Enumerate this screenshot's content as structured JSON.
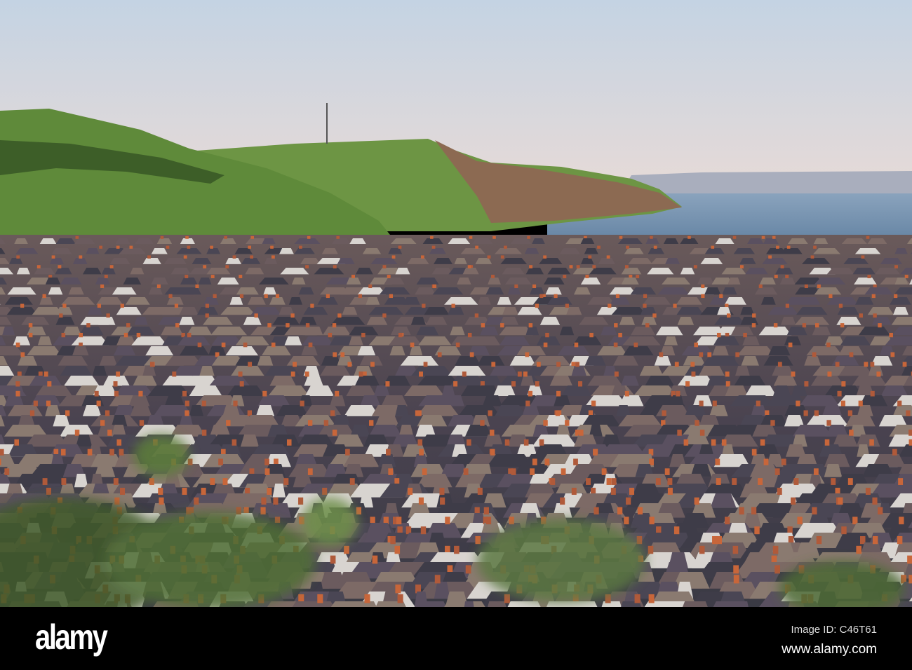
{
  "photo": {
    "subject": "coastal-town-at-sunset"
  },
  "footer": {
    "logo": "alamy",
    "image_id_label": "Image ID: C46T61",
    "website": "www.alamy.com"
  },
  "colors": {
    "sky_top": "#c4d3e3",
    "sky_bottom": "#eadbd6",
    "sea": "#6d8cab",
    "hill": "#5f8a3a",
    "roof": "#3e3c48",
    "chimney": "#c8663a"
  }
}
